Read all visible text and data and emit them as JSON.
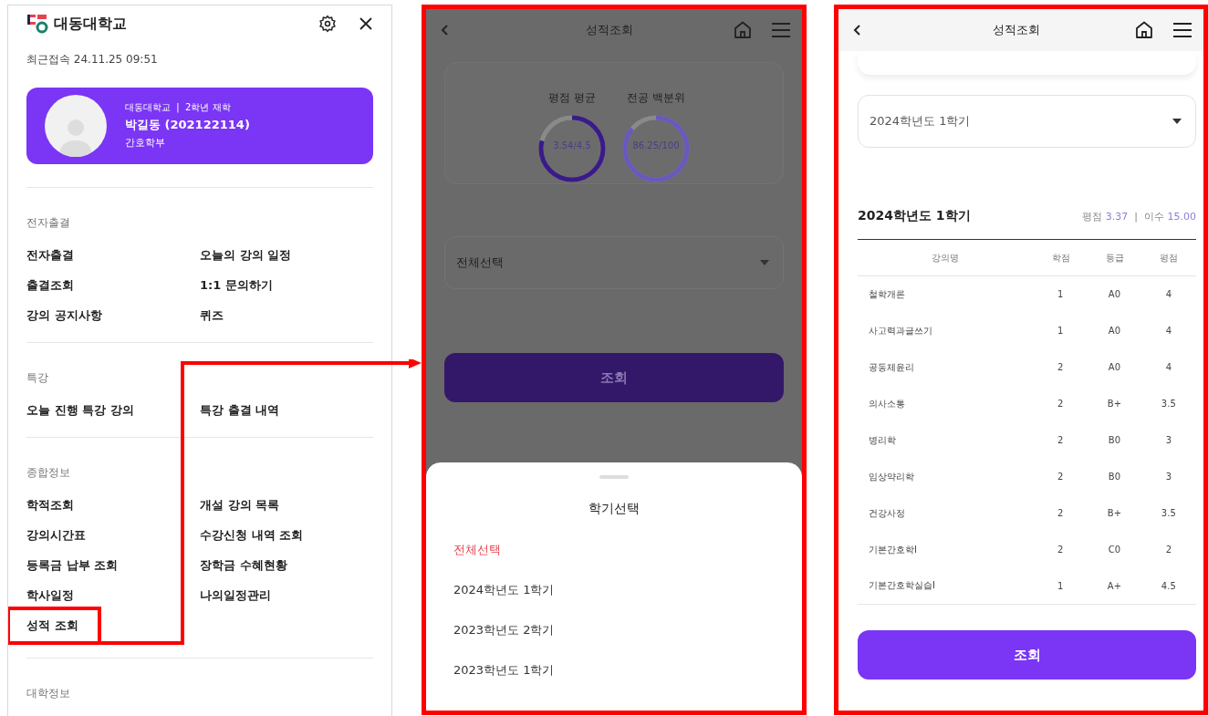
{
  "menu_panel": {
    "logo_text": "대동대학교",
    "last_access": "최근접속 24.11.25 09:51",
    "profile": {
      "school": "대동대학교",
      "separator": "|",
      "status": "2학년 재학",
      "name": "박길동 (202122114)",
      "department": "간호학부"
    },
    "sections": [
      {
        "title": "전자출결",
        "items": [
          {
            "label": "전자출결",
            "highlighted": false
          },
          {
            "label": "오늘의 강의 일정",
            "highlighted": false
          },
          {
            "label": "출결조회",
            "highlighted": false
          },
          {
            "label": "1:1 문의하기",
            "highlighted": false
          },
          {
            "label": "강의 공지사항",
            "highlighted": false
          },
          {
            "label": "퀴즈",
            "highlighted": false
          }
        ]
      },
      {
        "title": "특강",
        "items": [
          {
            "label": "오늘 진행 특강 강의",
            "highlighted": false
          },
          {
            "label": "특강 출결 내역",
            "highlighted": false
          }
        ]
      },
      {
        "title": "종합정보",
        "items": [
          {
            "label": "학적조회",
            "highlighted": false
          },
          {
            "label": "개설 강의 목록",
            "highlighted": false
          },
          {
            "label": "강의시간표",
            "highlighted": false
          },
          {
            "label": "수강신청 내역 조회",
            "highlighted": false
          },
          {
            "label": "등록금 납부 조회",
            "highlighted": false
          },
          {
            "label": "장학금 수혜현황",
            "highlighted": false
          },
          {
            "label": "학사일정",
            "highlighted": false
          },
          {
            "label": "나의일정관리",
            "highlighted": false
          },
          {
            "label": "성적 조회",
            "highlighted": true
          }
        ]
      },
      {
        "title": "대학정보"
      }
    ]
  },
  "grade_screen_sheet": {
    "title": "성적조회",
    "gauges": [
      {
        "label": "평점 평균",
        "reading": "3.54/4.5",
        "level": 0.79
      },
      {
        "label": "전공 백분위",
        "reading": "86.25/100",
        "level": 0.86
      }
    ],
    "select_value": "전체선택",
    "button": "조회",
    "sheet": {
      "title": "학기선택",
      "options": [
        {
          "label": "전체선택",
          "selected": true
        },
        {
          "label": "2024학년도 1학기",
          "selected": false
        },
        {
          "label": "2023학년도 2학기",
          "selected": false
        },
        {
          "label": "2023학년도 1학기",
          "selected": false
        }
      ]
    }
  },
  "grade_screen_result": {
    "title": "성적조회",
    "select_value": "2024학년도 1학기",
    "term_title": "2024학년도 1학기",
    "gpa_label": "평점",
    "gpa": "3.37",
    "separator": "|",
    "credits_label": "이수",
    "credits": "15.00",
    "table": {
      "columns": [
        "강의명",
        "학점",
        "등급",
        "평점"
      ],
      "rows": [
        [
          "철학개론",
          "1",
          "A0",
          "4"
        ],
        [
          "사고력과글쓰기",
          "1",
          "A0",
          "4"
        ],
        [
          "공동체윤리",
          "2",
          "A0",
          "4"
        ],
        [
          "의사소통",
          "2",
          "B+",
          "3.5"
        ],
        [
          "병리학",
          "2",
          "B0",
          "3"
        ],
        [
          "임상약리학",
          "2",
          "B0",
          "3"
        ],
        [
          "건강사정",
          "2",
          "B+",
          "3.5"
        ],
        [
          "기본간호학I",
          "2",
          "C0",
          "2"
        ],
        [
          "기본간호학실습I",
          "1",
          "A+",
          "4.5"
        ]
      ]
    },
    "button": "조회"
  }
}
